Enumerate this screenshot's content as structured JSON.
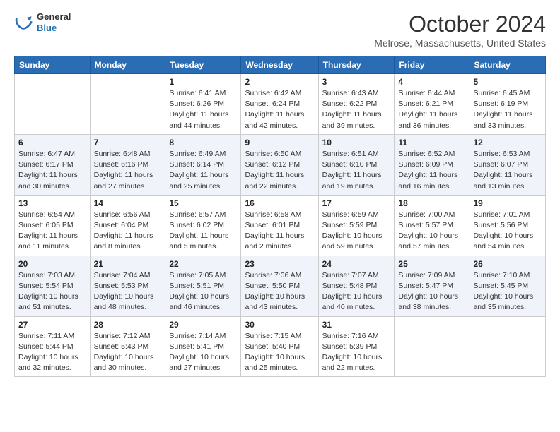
{
  "header": {
    "logo_line1": "General",
    "logo_line2": "Blue",
    "month_title": "October 2024",
    "location": "Melrose, Massachusetts, United States"
  },
  "weekdays": [
    "Sunday",
    "Monday",
    "Tuesday",
    "Wednesday",
    "Thursday",
    "Friday",
    "Saturday"
  ],
  "weeks": [
    [
      {
        "day": "",
        "info": ""
      },
      {
        "day": "",
        "info": ""
      },
      {
        "day": "1",
        "info": "Sunrise: 6:41 AM\nSunset: 6:26 PM\nDaylight: 11 hours and 44 minutes."
      },
      {
        "day": "2",
        "info": "Sunrise: 6:42 AM\nSunset: 6:24 PM\nDaylight: 11 hours and 42 minutes."
      },
      {
        "day": "3",
        "info": "Sunrise: 6:43 AM\nSunset: 6:22 PM\nDaylight: 11 hours and 39 minutes."
      },
      {
        "day": "4",
        "info": "Sunrise: 6:44 AM\nSunset: 6:21 PM\nDaylight: 11 hours and 36 minutes."
      },
      {
        "day": "5",
        "info": "Sunrise: 6:45 AM\nSunset: 6:19 PM\nDaylight: 11 hours and 33 minutes."
      }
    ],
    [
      {
        "day": "6",
        "info": "Sunrise: 6:47 AM\nSunset: 6:17 PM\nDaylight: 11 hours and 30 minutes."
      },
      {
        "day": "7",
        "info": "Sunrise: 6:48 AM\nSunset: 6:16 PM\nDaylight: 11 hours and 27 minutes."
      },
      {
        "day": "8",
        "info": "Sunrise: 6:49 AM\nSunset: 6:14 PM\nDaylight: 11 hours and 25 minutes."
      },
      {
        "day": "9",
        "info": "Sunrise: 6:50 AM\nSunset: 6:12 PM\nDaylight: 11 hours and 22 minutes."
      },
      {
        "day": "10",
        "info": "Sunrise: 6:51 AM\nSunset: 6:10 PM\nDaylight: 11 hours and 19 minutes."
      },
      {
        "day": "11",
        "info": "Sunrise: 6:52 AM\nSunset: 6:09 PM\nDaylight: 11 hours and 16 minutes."
      },
      {
        "day": "12",
        "info": "Sunrise: 6:53 AM\nSunset: 6:07 PM\nDaylight: 11 hours and 13 minutes."
      }
    ],
    [
      {
        "day": "13",
        "info": "Sunrise: 6:54 AM\nSunset: 6:05 PM\nDaylight: 11 hours and 11 minutes."
      },
      {
        "day": "14",
        "info": "Sunrise: 6:56 AM\nSunset: 6:04 PM\nDaylight: 11 hours and 8 minutes."
      },
      {
        "day": "15",
        "info": "Sunrise: 6:57 AM\nSunset: 6:02 PM\nDaylight: 11 hours and 5 minutes."
      },
      {
        "day": "16",
        "info": "Sunrise: 6:58 AM\nSunset: 6:01 PM\nDaylight: 11 hours and 2 minutes."
      },
      {
        "day": "17",
        "info": "Sunrise: 6:59 AM\nSunset: 5:59 PM\nDaylight: 10 hours and 59 minutes."
      },
      {
        "day": "18",
        "info": "Sunrise: 7:00 AM\nSunset: 5:57 PM\nDaylight: 10 hours and 57 minutes."
      },
      {
        "day": "19",
        "info": "Sunrise: 7:01 AM\nSunset: 5:56 PM\nDaylight: 10 hours and 54 minutes."
      }
    ],
    [
      {
        "day": "20",
        "info": "Sunrise: 7:03 AM\nSunset: 5:54 PM\nDaylight: 10 hours and 51 minutes."
      },
      {
        "day": "21",
        "info": "Sunrise: 7:04 AM\nSunset: 5:53 PM\nDaylight: 10 hours and 48 minutes."
      },
      {
        "day": "22",
        "info": "Sunrise: 7:05 AM\nSunset: 5:51 PM\nDaylight: 10 hours and 46 minutes."
      },
      {
        "day": "23",
        "info": "Sunrise: 7:06 AM\nSunset: 5:50 PM\nDaylight: 10 hours and 43 minutes."
      },
      {
        "day": "24",
        "info": "Sunrise: 7:07 AM\nSunset: 5:48 PM\nDaylight: 10 hours and 40 minutes."
      },
      {
        "day": "25",
        "info": "Sunrise: 7:09 AM\nSunset: 5:47 PM\nDaylight: 10 hours and 38 minutes."
      },
      {
        "day": "26",
        "info": "Sunrise: 7:10 AM\nSunset: 5:45 PM\nDaylight: 10 hours and 35 minutes."
      }
    ],
    [
      {
        "day": "27",
        "info": "Sunrise: 7:11 AM\nSunset: 5:44 PM\nDaylight: 10 hours and 32 minutes."
      },
      {
        "day": "28",
        "info": "Sunrise: 7:12 AM\nSunset: 5:43 PM\nDaylight: 10 hours and 30 minutes."
      },
      {
        "day": "29",
        "info": "Sunrise: 7:14 AM\nSunset: 5:41 PM\nDaylight: 10 hours and 27 minutes."
      },
      {
        "day": "30",
        "info": "Sunrise: 7:15 AM\nSunset: 5:40 PM\nDaylight: 10 hours and 25 minutes."
      },
      {
        "day": "31",
        "info": "Sunrise: 7:16 AM\nSunset: 5:39 PM\nDaylight: 10 hours and 22 minutes."
      },
      {
        "day": "",
        "info": ""
      },
      {
        "day": "",
        "info": ""
      }
    ]
  ]
}
